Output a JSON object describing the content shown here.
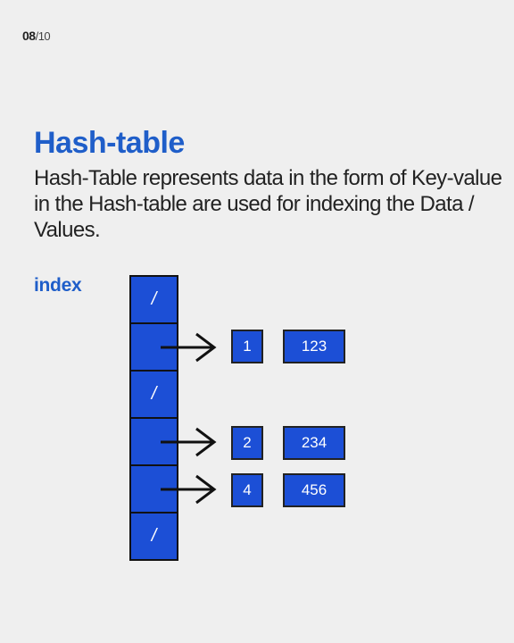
{
  "page": {
    "current": "08",
    "total": "/10"
  },
  "title": "Hash-table",
  "description": "Hash-Table represents  data in the form of Key-value in the Hash-table are used for indexing the Data / Values.",
  "diagram": {
    "index_label": "index",
    "slots": [
      "/",
      "",
      "/",
      "",
      "",
      "/"
    ],
    "nodes": [
      {
        "key": "1",
        "value": "123"
      },
      {
        "key": "2",
        "value": "234"
      },
      {
        "key": "4",
        "value": "456"
      }
    ],
    "colors": {
      "accent": "#1f5ec9",
      "cell_fill": "#1c4fd6",
      "cell_border": "#111111",
      "background": "#efefef"
    }
  }
}
